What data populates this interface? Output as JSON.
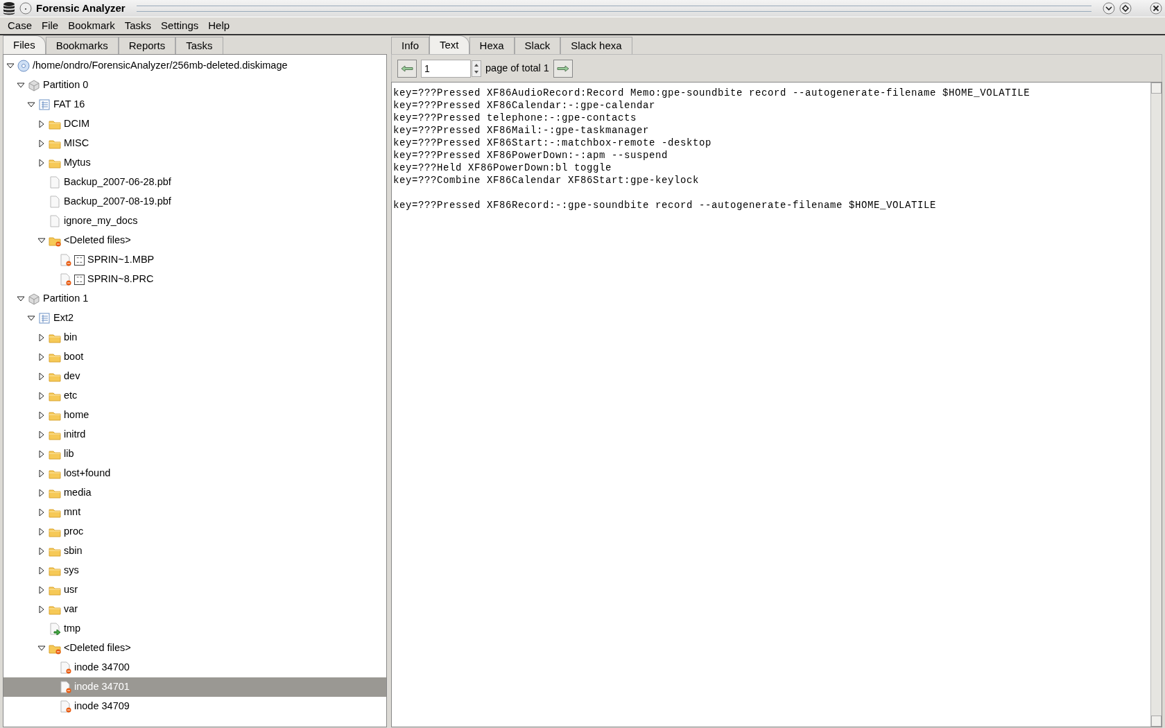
{
  "window": {
    "title": "Forensic Analyzer"
  },
  "menu": [
    "Case",
    "File",
    "Bookmark",
    "Tasks",
    "Settings",
    "Help"
  ],
  "left_tabs": [
    {
      "label": "Files",
      "selected": true
    },
    {
      "label": "Bookmarks",
      "selected": false
    },
    {
      "label": "Reports",
      "selected": false
    },
    {
      "label": "Tasks",
      "selected": false
    }
  ],
  "tree": [
    {
      "label": "/home/ondro/ForensicAnalyzer/256mb-deleted.diskimage",
      "kind": "disk",
      "expanded": true,
      "selected": false,
      "children": [
        {
          "label": "Partition 0",
          "kind": "partition",
          "expanded": true,
          "selected": false,
          "children": [
            {
              "label": "FAT 16",
              "kind": "filesystem",
              "expanded": true,
              "selected": false,
              "children": [
                {
                  "label": "DCIM",
                  "kind": "folder",
                  "expanded": false,
                  "selected": false
                },
                {
                  "label": "MISC",
                  "kind": "folder",
                  "expanded": false,
                  "selected": false
                },
                {
                  "label": "Mytus",
                  "kind": "folder",
                  "expanded": false,
                  "selected": false
                },
                {
                  "label": "Backup_2007-06-28.pbf",
                  "kind": "file",
                  "selected": false
                },
                {
                  "label": "Backup_2007-08-19.pbf",
                  "kind": "file",
                  "selected": false
                },
                {
                  "label": "ignore_my_docs",
                  "kind": "file",
                  "selected": false
                },
                {
                  "label": "<Deleted files>",
                  "kind": "deleted-folder",
                  "expanded": true,
                  "selected": false,
                  "children": [
                    {
                      "label": "SPRIN~1.MBP",
                      "kind": "deleted-typed",
                      "selected": false
                    },
                    {
                      "label": "SPRIN~8.PRC",
                      "kind": "deleted-typed",
                      "selected": false
                    }
                  ]
                }
              ]
            }
          ]
        },
        {
          "label": "Partition 1",
          "kind": "partition",
          "expanded": true,
          "selected": false,
          "children": [
            {
              "label": "Ext2",
              "kind": "filesystem",
              "expanded": true,
              "selected": false,
              "children": [
                {
                  "label": "bin",
                  "kind": "folder",
                  "expanded": false,
                  "selected": false
                },
                {
                  "label": "boot",
                  "kind": "folder",
                  "expanded": false,
                  "selected": false
                },
                {
                  "label": "dev",
                  "kind": "folder",
                  "expanded": false,
                  "selected": false
                },
                {
                  "label": "etc",
                  "kind": "folder",
                  "expanded": false,
                  "selected": false
                },
                {
                  "label": "home",
                  "kind": "folder",
                  "expanded": false,
                  "selected": false
                },
                {
                  "label": "initrd",
                  "kind": "folder",
                  "expanded": false,
                  "selected": false
                },
                {
                  "label": "lib",
                  "kind": "folder",
                  "expanded": false,
                  "selected": false
                },
                {
                  "label": "lost+found",
                  "kind": "folder",
                  "expanded": false,
                  "selected": false
                },
                {
                  "label": "media",
                  "kind": "folder",
                  "expanded": false,
                  "selected": false
                },
                {
                  "label": "mnt",
                  "kind": "folder",
                  "expanded": false,
                  "selected": false
                },
                {
                  "label": "proc",
                  "kind": "folder",
                  "expanded": false,
                  "selected": false
                },
                {
                  "label": "sbin",
                  "kind": "folder",
                  "expanded": false,
                  "selected": false
                },
                {
                  "label": "sys",
                  "kind": "folder",
                  "expanded": false,
                  "selected": false
                },
                {
                  "label": "usr",
                  "kind": "folder",
                  "expanded": false,
                  "selected": false
                },
                {
                  "label": "var",
                  "kind": "folder",
                  "expanded": false,
                  "selected": false
                },
                {
                  "label": "tmp",
                  "kind": "link",
                  "selected": false
                },
                {
                  "label": "<Deleted files>",
                  "kind": "deleted-folder",
                  "expanded": true,
                  "selected": false,
                  "children": [
                    {
                      "label": "inode 34700",
                      "kind": "deleted-file",
                      "selected": false
                    },
                    {
                      "label": "inode 34701",
                      "kind": "deleted-file",
                      "selected": true
                    },
                    {
                      "label": "inode 34709",
                      "kind": "deleted-file",
                      "selected": false
                    }
                  ]
                }
              ]
            }
          ]
        }
      ]
    }
  ],
  "right_tabs": [
    {
      "label": "Info",
      "selected": false
    },
    {
      "label": "Text",
      "selected": true
    },
    {
      "label": "Hexa",
      "selected": false
    },
    {
      "label": "Slack",
      "selected": false
    },
    {
      "label": "Slack hexa",
      "selected": false
    }
  ],
  "pager": {
    "page": "1",
    "label": "page of total 1"
  },
  "text_content": "key=???Pressed XF86AudioRecord:Record Memo:gpe-soundbite record --autogenerate-filename $HOME_VOLATILE\nkey=???Pressed XF86Calendar:-:gpe-calendar\nkey=???Pressed telephone:-:gpe-contacts\nkey=???Pressed XF86Mail:-:gpe-taskmanager\nkey=???Pressed XF86Start:-:matchbox-remote -desktop\nkey=???Pressed XF86PowerDown:-:apm --suspend\nkey=???Held XF86PowerDown:bl toggle\nkey=???Combine XF86Calendar XF86Start:gpe-keylock\n\nkey=???Pressed XF86Record:-:gpe-soundbite record --autogenerate-filename $HOME_VOLATILE"
}
